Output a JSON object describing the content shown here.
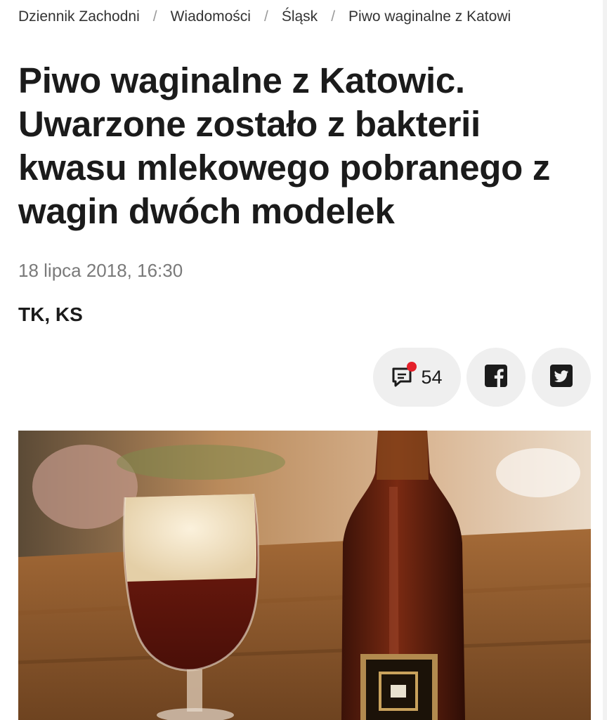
{
  "breadcrumb": {
    "items": [
      "Dziennik Zachodni",
      "Wiadomości",
      "Śląsk",
      "Piwo waginalne z Katowi"
    ],
    "separator": "/"
  },
  "article": {
    "title": "Piwo waginalne z Katowic. Uwarzone zostało z bakterii kwasu mlekowego pobranego z wagin dwóch modelek",
    "date": "18 lipca 2018, 16:30",
    "authors": "TK, KS"
  },
  "social": {
    "comments_count": "54",
    "comment_icon": "comment-icon",
    "facebook_icon": "facebook-icon",
    "twitter_icon": "twitter-icon",
    "notification_color": "#e4202a"
  },
  "hero_image": {
    "description_icon": "beer-glass-and-bottle-photo"
  }
}
